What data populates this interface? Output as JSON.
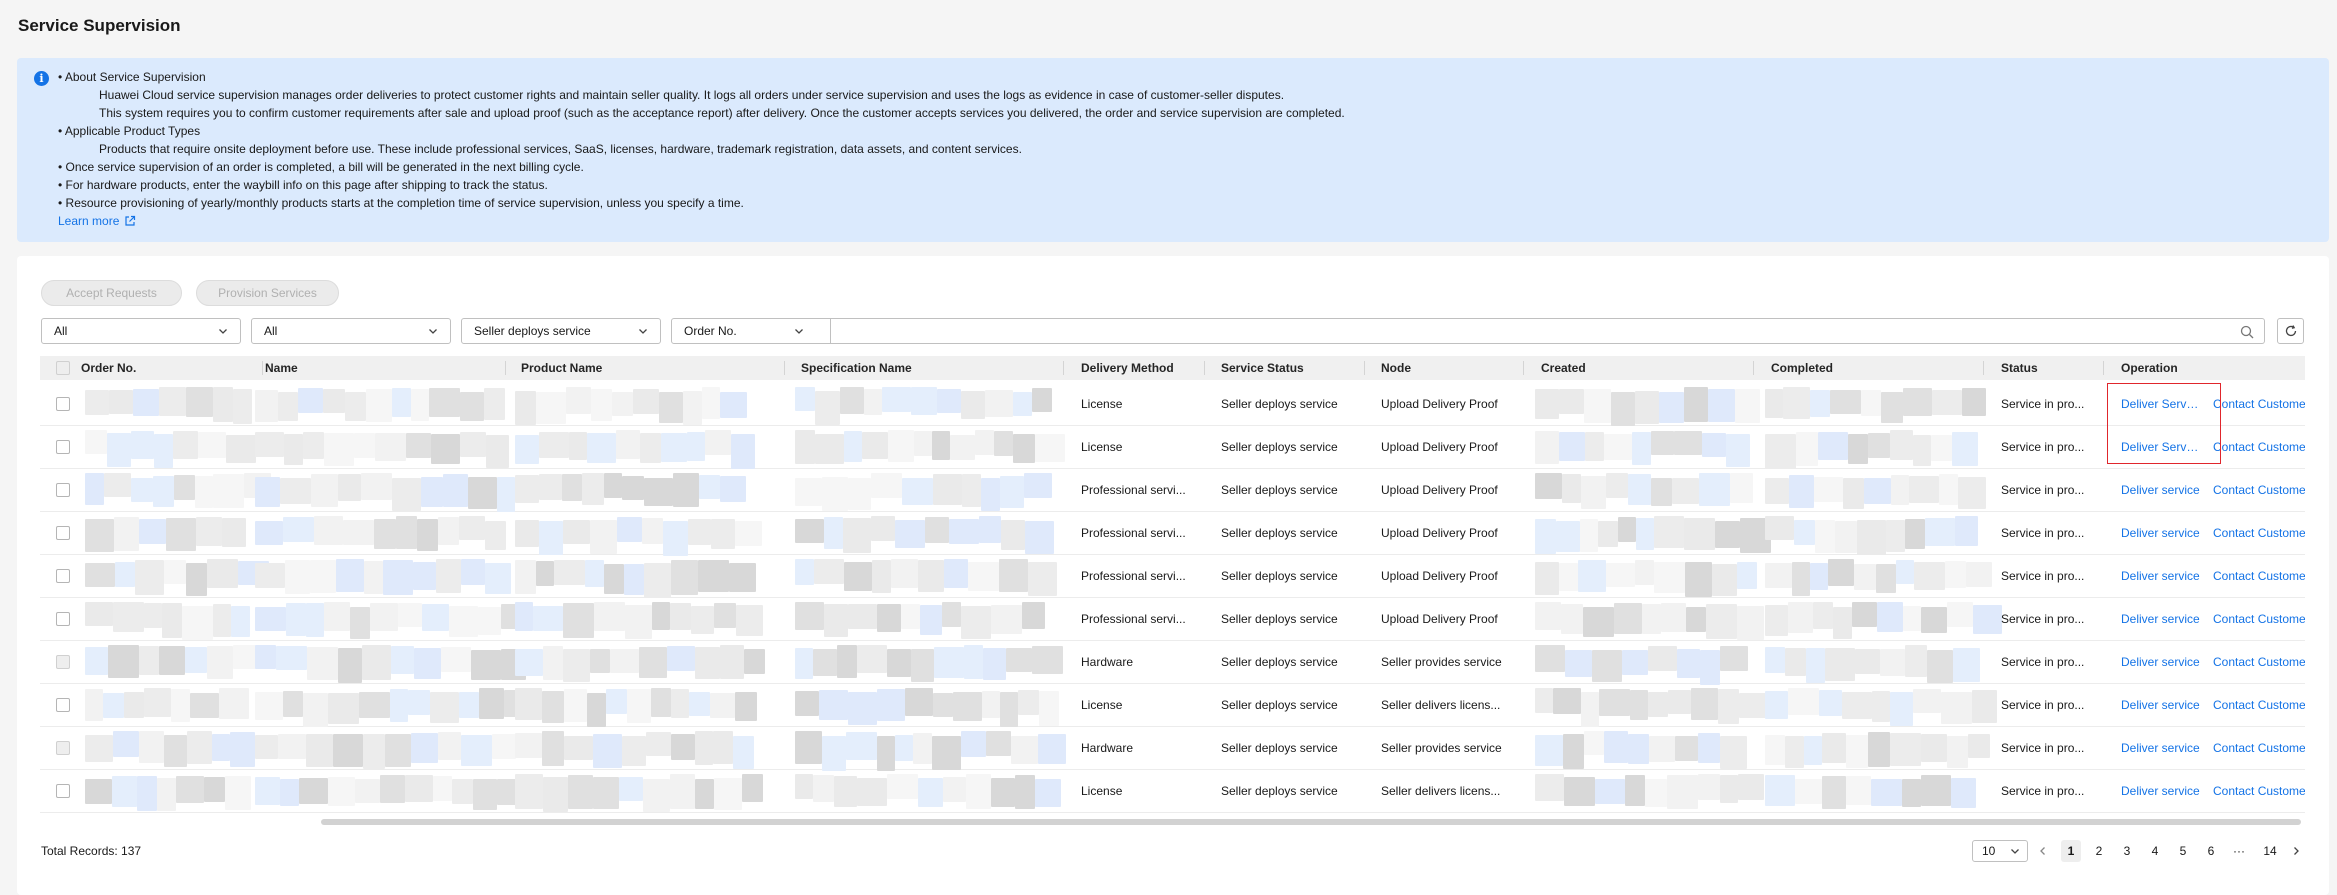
{
  "page_title": "Service Supervision",
  "banner": {
    "lines": [
      "• About Service Supervision",
      "Huawei Cloud service supervision manages order deliveries to protect customer rights and maintain seller quality. It logs all orders under service supervision and uses the logs as evidence in case of customer-seller disputes.",
      "This system requires you to confirm customer requirements after sale and upload proof (such as the acceptance report) after delivery. Once the customer accepts services you delivered, the order and service supervision are completed.",
      "• Applicable Product Types",
      "Products that require onsite deployment before use. These include professional services, SaaS, licenses, hardware, trademark registration, data assets, and content services.",
      "• Once service supervision of an order is completed, a bill will be generated in the next billing cycle.",
      "• For hardware products, enter the waybill info on this page after shipping to track the status.",
      "• Resource provisioning of yearly/monthly products starts at the completion time of service supervision, unless you specify a time."
    ],
    "learn_more": "Learn more"
  },
  "toolbar": {
    "accept_requests": "Accept Requests",
    "provision_services": "Provision Services"
  },
  "filters": {
    "filter1": "All",
    "filter2": "All",
    "filter3": "Seller deploys service",
    "search_key": "Order No."
  },
  "table": {
    "headers": {
      "order_no": "Order No.",
      "name": "Name",
      "product_name": "Product Name",
      "spec_name": "Specification Name",
      "delivery_method": "Delivery Method",
      "service_status": "Service Status",
      "node": "Node",
      "created": "Created",
      "completed": "Completed",
      "status": "Status",
      "operation": "Operation"
    },
    "rows": [
      {
        "delivery": "License",
        "service_status": "Seller deploys service",
        "node": "Upload Delivery Proof",
        "status": "Service in pro...",
        "op1": "Deliver Service",
        "op2": "Contact Custome"
      },
      {
        "delivery": "License",
        "service_status": "Seller deploys service",
        "node": "Upload Delivery Proof",
        "status": "Service in pro...",
        "op1": "Deliver Service",
        "op2": "Contact Custome"
      },
      {
        "delivery": "Professional servi...",
        "service_status": "Seller deploys service",
        "node": "Upload Delivery Proof",
        "status": "Service in pro...",
        "op1": "Deliver service",
        "op2": "Contact Custome"
      },
      {
        "delivery": "Professional servi...",
        "service_status": "Seller deploys service",
        "node": "Upload Delivery Proof",
        "status": "Service in pro...",
        "op1": "Deliver service",
        "op2": "Contact Custome"
      },
      {
        "delivery": "Professional servi...",
        "service_status": "Seller deploys service",
        "node": "Upload Delivery Proof",
        "status": "Service in pro...",
        "op1": "Deliver service",
        "op2": "Contact Custome"
      },
      {
        "delivery": "Professional servi...",
        "service_status": "Seller deploys service",
        "node": "Upload Delivery Proof",
        "status": "Service in pro...",
        "op1": "Deliver service",
        "op2": "Contact Custome"
      },
      {
        "delivery": "Hardware",
        "service_status": "Seller deploys service",
        "node": "Seller provides service",
        "status": "Service in pro...",
        "op1": "Deliver service",
        "op2": "Contact Custome"
      },
      {
        "delivery": "License",
        "service_status": "Seller deploys service",
        "node": "Seller delivers licens...",
        "status": "Service in pro...",
        "op1": "Deliver service",
        "op2": "Contact Custome"
      },
      {
        "delivery": "Hardware",
        "service_status": "Seller deploys service",
        "node": "Seller provides service",
        "status": "Service in pro...",
        "op1": "Deliver service",
        "op2": "Contact Custome"
      },
      {
        "delivery": "License",
        "service_status": "Seller deploys service",
        "node": "Seller delivers licens...",
        "status": "Service in pro...",
        "op1": "Deliver service",
        "op2": "Contact Custome"
      }
    ]
  },
  "footer": {
    "total_records": "Total Records: 137",
    "page_size": "10",
    "pages": [
      "1",
      "2",
      "3",
      "4",
      "5",
      "6",
      "···",
      "14"
    ],
    "current_page": "1"
  },
  "colors": {
    "accent": "#1473e6",
    "banner_bg": "#dbeafd",
    "highlight": "#e0262c"
  }
}
